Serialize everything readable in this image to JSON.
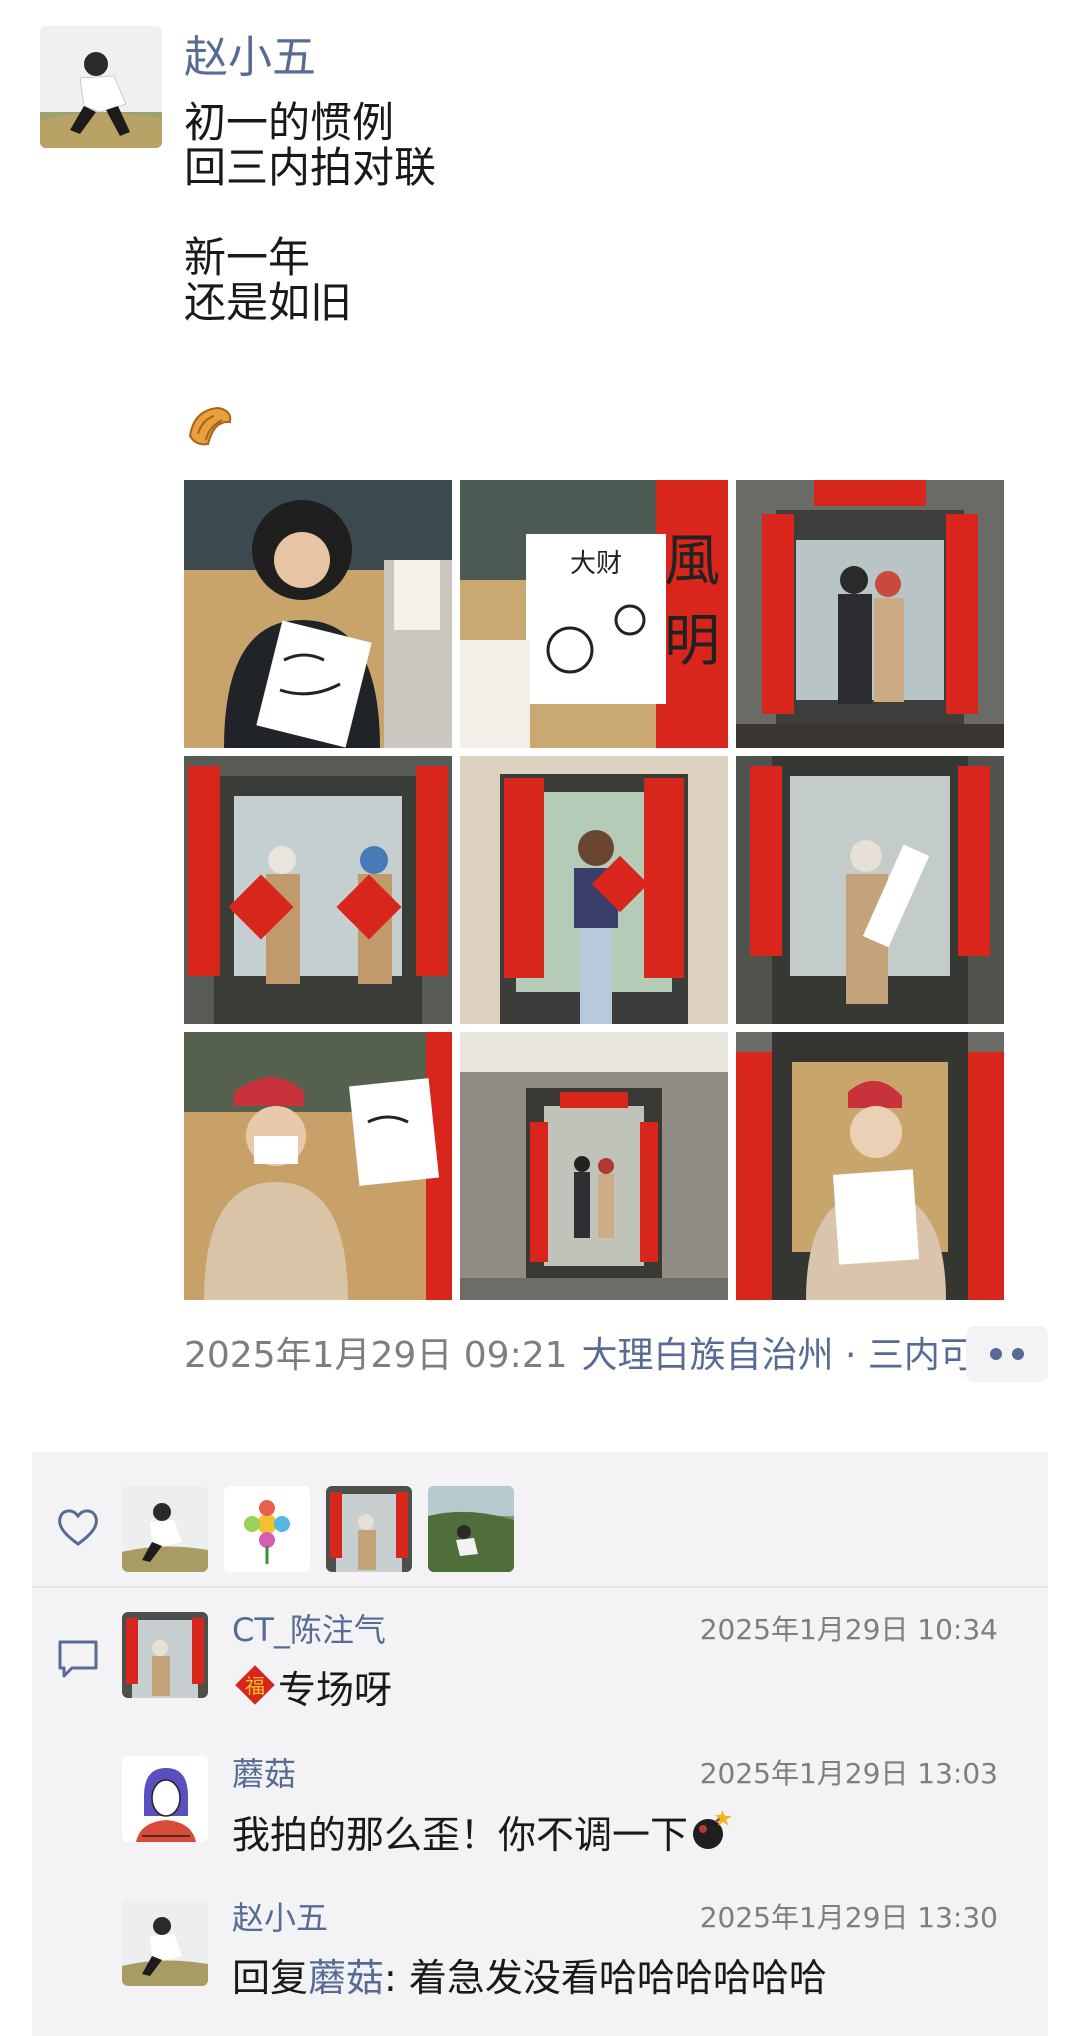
{
  "post": {
    "author": "赵小五",
    "text": "初一的惯例\n回三内拍对联\n\n新一年\n还是如旧",
    "emoji_icon": "croissant-icon",
    "photos": [
      {
        "icon": "photo-icon"
      },
      {
        "icon": "photo-icon"
      },
      {
        "icon": "photo-icon"
      },
      {
        "icon": "photo-icon"
      },
      {
        "icon": "photo-icon"
      },
      {
        "icon": "photo-icon"
      },
      {
        "icon": "photo-icon"
      },
      {
        "icon": "photo-icon"
      },
      {
        "icon": "photo-icon"
      }
    ],
    "time": "2025年1月29日 09:21",
    "location": "大理白族自治州 · 三内可"
  },
  "likes": {
    "icon": "heart-icon",
    "count": 4
  },
  "comments": [
    {
      "name": "CT_陈注气",
      "time": "2025年1月29日 10:34",
      "emoji": "fu-icon",
      "text": "专场呀"
    },
    {
      "name": "蘑菇",
      "time": "2025年1月29日 13:03",
      "text": "我拍的那么歪！你不调一下",
      "emoji": "bomb-icon"
    },
    {
      "name": "赵小五",
      "time": "2025年1月29日 13:30",
      "reply_prefix": "回复",
      "reply_to": "蘑菇",
      "reply_sep": ": ",
      "text": "着急发没看哈哈哈哈哈哈"
    }
  ],
  "colors": {
    "link": "#576b95",
    "meta": "#7e7e7e",
    "panel": "#f3f3f5",
    "red": "#d8261d"
  }
}
